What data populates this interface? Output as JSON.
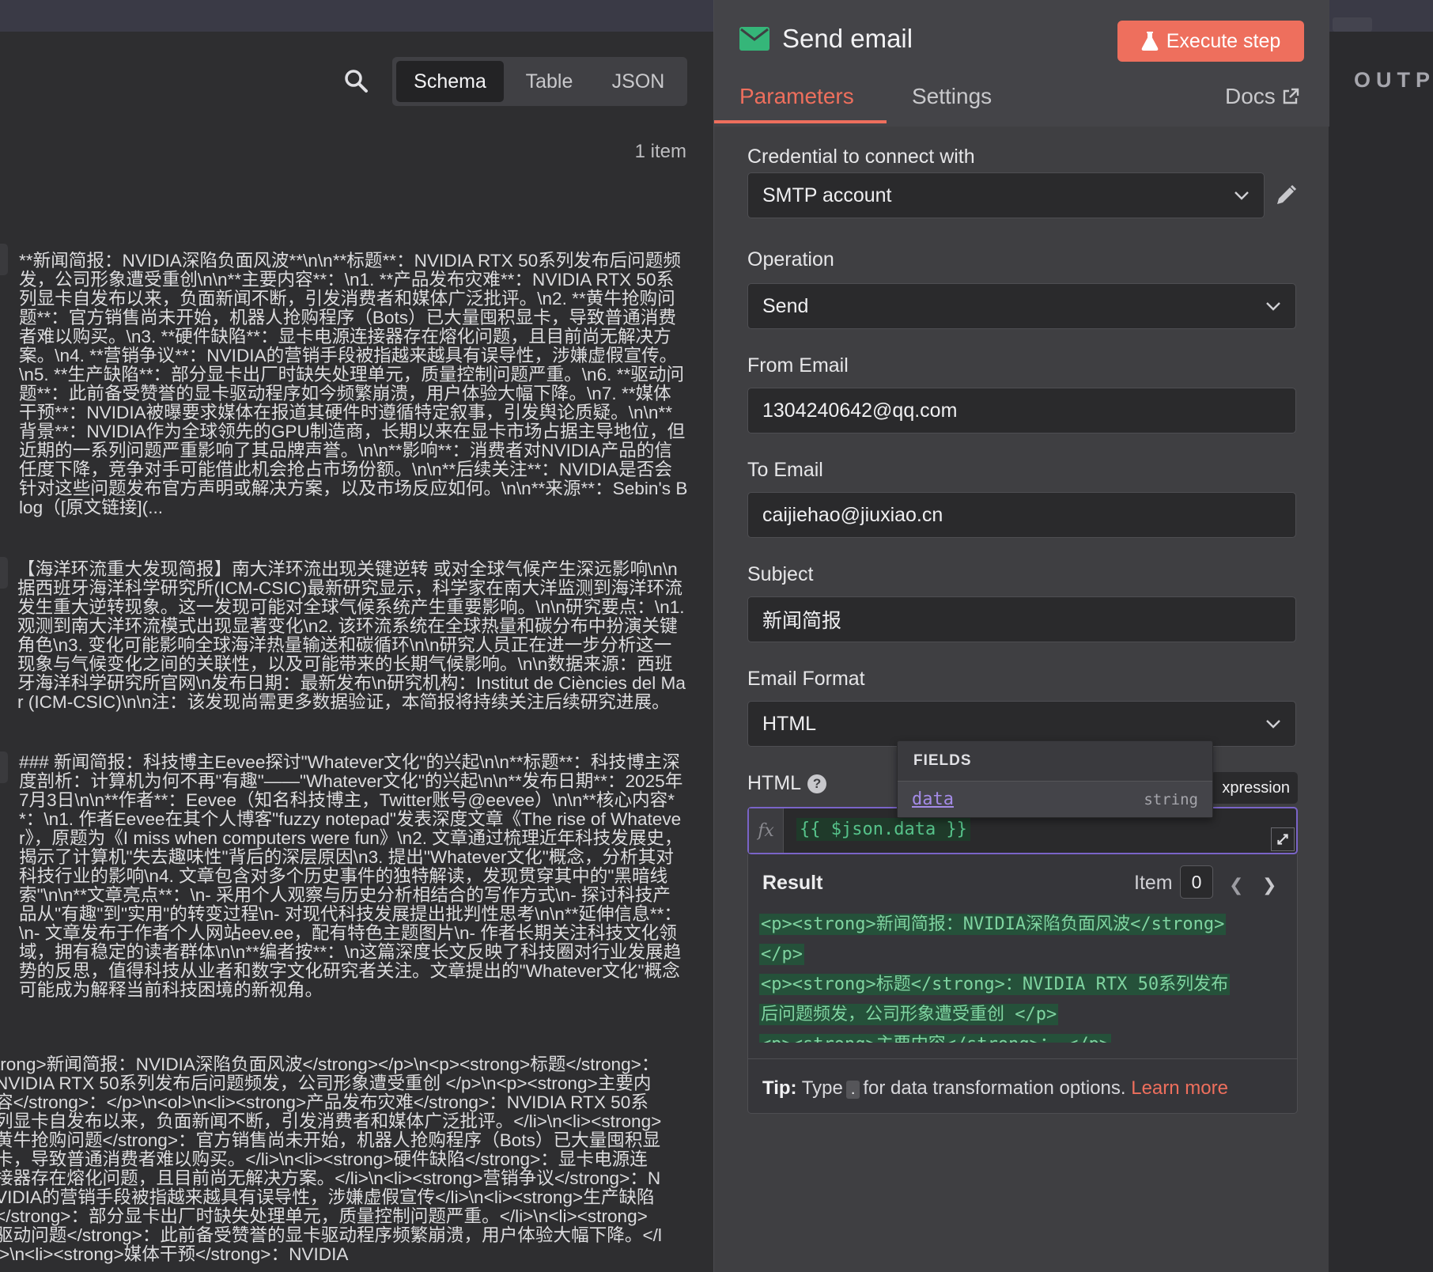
{
  "left_panel": {
    "view_tabs": [
      "Schema",
      "Table",
      "JSON"
    ],
    "active_view": "Schema",
    "item_count": "1 item",
    "records": [
      "**新闻简报：NVIDIA深陷负面风波**\\n\\n**标题**：NVIDIA RTX 50系列发布后问题频发，公司形象遭受重创\\n\\n**主要内容**：\\n1. **产品发布灾难**：NVIDIA RTX 50系列显卡自发布以来，负面新闻不断，引发消费者和媒体广泛批评。\\n2. **黄牛抢购问题**：官方销售尚未开始，机器人抢购程序（Bots）已大量囤积显卡，导致普通消费者难以购买。\\n3. **硬件缺陷**：显卡电源连接器存在熔化问题，且目前尚无解决方案。\\n4. **营销争议**：NVIDIA的营销手段被指越来越具有误导性，涉嫌虚假宣传。\\n5. **生产缺陷**：部分显卡出厂时缺失处理单元，质量控制问题严重。\\n6. **驱动问题**：此前备受赞誉的显卡驱动程序如今频繁崩溃，用户体验大幅下降。\\n7. **媒体干预**：NVIDIA被曝要求媒体在报道其硬件时遵循特定叙事，引发舆论质疑。\\n\\n**背景**：NVIDIA作为全球领先的GPU制造商，长期以来在显卡市场占据主导地位，但近期的一系列问题严重影响了其品牌声誉。\\n\\n**影响**：消费者对NVIDIA产品的信任度下降，竞争对手可能借此机会抢占市场份额。\\n\\n**后续关注**：NVIDIA是否会针对这些问题发布官方声明或解决方案，以及市场反应如何。\\n\\n**来源**：Sebin's Blog（[原文链接](...",
      "【海洋环流重大发现简报】南大洋环流出现关键逆转 或对全球气候产生深远影响\\n\\n据西班牙海洋科学研究所(ICM-CSIC)最新研究显示，科学家在南大洋监测到海洋环流发生重大逆转现象。这一发现可能对全球气候系统产生重要影响。\\n\\n研究要点：\\n1. 观测到南大洋环流模式出现显著变化\\n2. 该环流系统在全球热量和碳分布中扮演关键角色\\n3. 变化可能影响全球海洋热量输送和碳循环\\n\\n研究人员正在进一步分析这一现象与气候变化之间的关联性，以及可能带来的长期气候影响。\\n\\n数据来源：西班牙海洋科学研究所官网\\n发布日期：最新发布\\n研究机构：Institut de Ciències del Mar (ICM-CSIC)\\n\\n注：该发现尚需更多数据验证，本简报将持续关注后续研究进展。",
      "### 新闻简报：科技博主Eevee探讨\"Whatever文化\"的兴起\\n\\n**标题**：科技博主深度剖析：计算机为何不再\"有趣\"——\"Whatever文化\"的兴起\\n\\n**发布日期**：2025年7月3日\\n\\n**作者**：Eevee（知名科技博主，Twitter账号@eevee）\\n\\n**核心内容**：\\n1. 作者Eevee在其个人博客\"fuzzy notepad\"发表深度文章《The rise of Whatever》，原题为《I miss when computers were fun》\\n2. 文章通过梳理近年科技发展史，揭示了计算机\"失去趣味性\"背后的深层原因\\n3. 提出\"Whatever文化\"概念，分析其对科技行业的影响\\n4. 文章包含对多个历史事件的独特解读，发现贯穿其中的\"黑暗线索\"\\n\\n**文章亮点**：\\n- 采用个人观察与历史分析相结合的写作方式\\n- 探讨科技产品从\"有趣\"到\"实用\"的转变过程\\n- 对现代科技发展提出批判性思考\\n\\n**延伸信息**：\\n- 文章发布于作者个人网站eev.ee，配有特色主题图片\\n- 作者长期关注科技文化领域，拥有稳定的读者群体\\n\\n**编者按**：\\n这篇深度长文反映了科技圈对行业发展趋势的反思，值得科技从业者和数字文化研究者关注。文章提出的\"Whatever文化\"概念可能成为解释当前科技困境的新视角。",
      "trong>新闻简报：NVIDIA深陷负面风波</strong></p>\\n<p><strong>标题</strong>：NVIDIA RTX 50系列发布后问题频发，公司形象遭受重创 </p>\\n<p><strong>主要内容</strong>：</p>\\n<ol>\\n<li><strong>产品发布灾难</strong>：NVIDIA RTX 50系列显卡自发布以来，负面新闻不断，引发消费者和媒体广泛批评。</li>\\n<li><strong>黄牛抢购问题</strong>：官方销售尚未开始，机器人抢购程序（Bots）已大量囤积显卡，导致普通消费者难以购买。</li>\\n<li><strong>硬件缺陷</strong>：显卡电源连接器存在熔化问题，且目前尚无解决方案。</li>\\n<li><strong>营销争议</strong>：NVIDIA的营销手段被指越来越具有误导性，涉嫌虚假宣传</li>\\n<li><strong>生产缺陷</strong>：部分显卡出厂时缺失处理单元，质量控制问题严重。</li>\\n<li><strong>驱动问题</strong>：此前备受赞誉的显卡驱动程序频繁崩溃，用户体验大幅下降。</li>\\n<li><strong>媒体干预</strong>：NVIDIA"
    ]
  },
  "node": {
    "title": "Send email",
    "execute_label": "Execute step",
    "tabs": {
      "parameters": "Parameters",
      "settings": "Settings",
      "docs": "Docs"
    },
    "credential": {
      "label": "Credential to connect with",
      "value": "SMTP account"
    },
    "operation": {
      "label": "Operation",
      "value": "Send"
    },
    "from_email": {
      "label": "From Email",
      "value": "1304240642@qq.com"
    },
    "to_email": {
      "label": "To Email",
      "value": "caijiehao@jiuxiao.cn"
    },
    "subject": {
      "label": "Subject",
      "value": "新闻简报"
    },
    "email_format": {
      "label": "Email Format",
      "value": "HTML"
    },
    "html": {
      "label": "HTML",
      "mode_tag": "xpression",
      "fx": "fx",
      "expression": "{{ $json.data }}"
    },
    "result": {
      "label": "Result",
      "item_label": "Item",
      "item_index": "0",
      "lines": [
        "<p><strong>新闻简报：NVIDIA深陷负面风波</strong>",
        "</p>",
        "<p><strong>标题</strong>：NVIDIA RTX 50系列发布",
        "后问题频发，公司形象遭受重创 </p>",
        "<p><strong>主要内容</strong>： </p>"
      ]
    },
    "tip": {
      "bold": "Tip:",
      "before": "Type",
      "key": ".",
      "after": "for data transformation options.",
      "link": "Learn more"
    }
  },
  "fields_popup": {
    "heading": "FIELDS",
    "field_name": "data",
    "field_type": "string"
  },
  "output_panel": {
    "label": "OUTP"
  },
  "colors": {
    "accent": "#ee6f5d",
    "expression_border": "#7a64c8",
    "code_green": "#56c28a",
    "mail_green": "#35b679"
  }
}
